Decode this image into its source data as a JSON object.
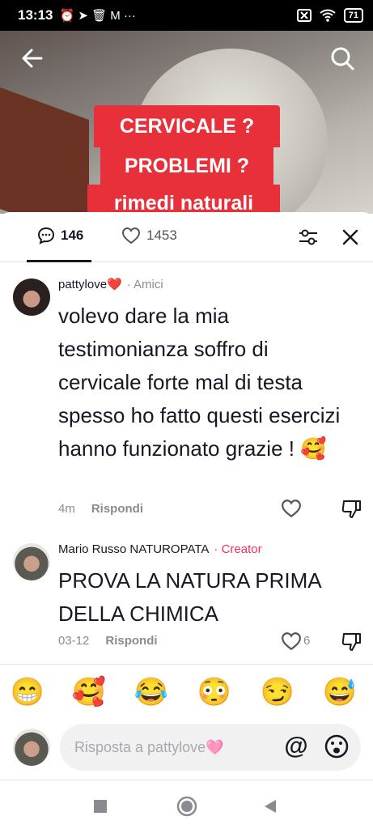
{
  "status_bar": {
    "time": "13:13",
    "icons": "⏰ ➤ 🗑 M ···",
    "battery": "71"
  },
  "video": {
    "caption_lines": [
      "CERVICALE ?",
      "PROBLEMI ?",
      "rimedi naturali"
    ]
  },
  "tabs": {
    "comments_count": "146",
    "likes_count": "1453"
  },
  "comments": [
    {
      "username": "pattylove❤️",
      "tag": "· Amici",
      "text": "volevo dare la mia testimonianza soffro di cervicale forte mal di testa spesso ho fatto questi esercizi hanno funzionato grazie ! 🥰",
      "time": "4m",
      "reply_label": "Rispondi",
      "likes": ""
    },
    {
      "username": "Mario Russo NATUROPATA",
      "tag": "· Creator",
      "text": "PROVA LA NATURA PRIMA DELLA CHIMICA",
      "time": "03-12",
      "reply_label": "Rispondi",
      "likes": "6"
    }
  ],
  "emoji_bar": [
    "😁",
    "🥰",
    "😂",
    "😳",
    "😏",
    "😅"
  ],
  "reply_input": {
    "placeholder": "Risposta a pattylove🩷"
  },
  "colors": {
    "accent": "#fe2c55",
    "caption_bg": "#e8303a",
    "muted": "#8a8b91"
  }
}
